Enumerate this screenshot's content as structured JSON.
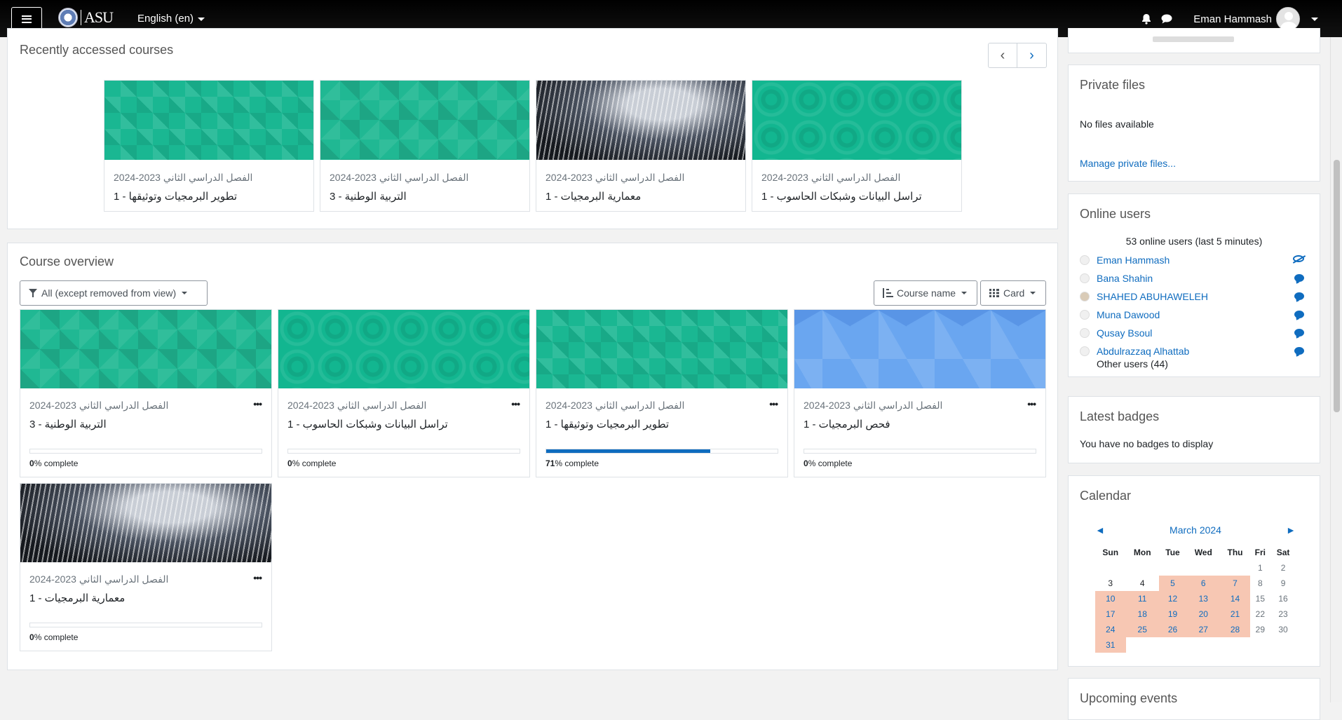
{
  "navbar": {
    "logo_text": "ASU",
    "language": "English (en)",
    "user_name": "Eman Hammash"
  },
  "recent": {
    "title": "Recently accessed courses",
    "prev_icon": "chevron-left-icon",
    "next_icon": "chevron-right-icon",
    "cards": [
      {
        "category": "الفصل الدراسي الثاني 2023-2024",
        "name": "تطوير البرمجيات وتوثيقها - 1",
        "pattern": "diamond"
      },
      {
        "category": "الفصل الدراسي الثاني 2023-2024",
        "name": "التربية الوطنية - 3",
        "pattern": "diamond2"
      },
      {
        "category": "الفصل الدراسي الثاني 2023-2024",
        "name": "معمارية البرمجيات - 1",
        "pattern": "arch"
      },
      {
        "category": "الفصل الدراسي الثاني 2023-2024",
        "name": "تراسل البيانات وشبكات الحاسوب - 1",
        "pattern": "circles"
      }
    ]
  },
  "overview": {
    "title": "Course overview",
    "filter_label": "All (except removed from view)",
    "sort_label": "Course name",
    "view_label": "Card",
    "complete_suffix": "% complete",
    "cards": [
      {
        "category": "الفصل الدراسي الثاني 2023-2024",
        "name": "التربية الوطنية - 3",
        "progress": 0,
        "pattern": "diamond2"
      },
      {
        "category": "الفصل الدراسي الثاني 2023-2024",
        "name": "تراسل البيانات وشبكات الحاسوب - 1",
        "progress": 0,
        "pattern": "circles"
      },
      {
        "category": "الفصل الدراسي الثاني 2023-2024",
        "name": "تطوير البرمجيات وتوثيقها - 1",
        "progress": 71,
        "pattern": "diamond"
      },
      {
        "category": "الفصل الدراسي الثاني 2023-2024",
        "name": "فحص البرمجيات - 1",
        "progress": 0,
        "pattern": "hex"
      },
      {
        "category": "الفصل الدراسي الثاني 2023-2024",
        "name": "معمارية البرمجيات - 1",
        "progress": 0,
        "pattern": "arch"
      }
    ]
  },
  "private_files": {
    "title": "Private files",
    "empty_text": "No files available",
    "manage_link": "Manage private files..."
  },
  "online_users": {
    "title": "Online users",
    "summary": "53 online users (last 5 minutes)",
    "users": [
      {
        "name": "Eman Hammash",
        "action_icon": "eye-slash-icon"
      },
      {
        "name": "Bana Shahin",
        "action_icon": "message-icon"
      },
      {
        "name": "SHAHED ABUHAWELEH",
        "action_icon": "message-icon"
      },
      {
        "name": "Muna Dawood",
        "action_icon": "message-icon"
      },
      {
        "name": "Qusay Bsoul",
        "action_icon": "message-icon"
      },
      {
        "name": "Abdulrazzaq Alhattab",
        "action_icon": "message-icon"
      }
    ],
    "other_users": "Other users (44)"
  },
  "badges": {
    "title": "Latest badges",
    "empty_text": "You have no badges to display"
  },
  "calendar": {
    "title": "Calendar",
    "month": "March 2024",
    "prev": "◄",
    "next": "►",
    "weekdays": [
      "Sun",
      "Mon",
      "Tue",
      "Wed",
      "Thu",
      "Fri",
      "Sat"
    ],
    "weeks": [
      [
        "",
        "",
        "",
        "",
        "",
        "1",
        "2"
      ],
      [
        "3",
        "4",
        "5",
        "6",
        "7",
        "8",
        "9"
      ],
      [
        "10",
        "11",
        "12",
        "13",
        "14",
        "15",
        "16"
      ],
      [
        "17",
        "18",
        "19",
        "20",
        "21",
        "22",
        "23"
      ],
      [
        "24",
        "25",
        "26",
        "27",
        "28",
        "29",
        "30"
      ],
      [
        "31",
        "",
        "",
        "",
        "",
        "",
        ""
      ]
    ],
    "event_days": [
      "5",
      "6",
      "7",
      "10",
      "11",
      "12",
      "13",
      "14",
      "17",
      "18",
      "19",
      "20",
      "21",
      "24",
      "25",
      "26",
      "27",
      "28",
      "31"
    ]
  },
  "upcoming": {
    "title": "Upcoming events"
  }
}
